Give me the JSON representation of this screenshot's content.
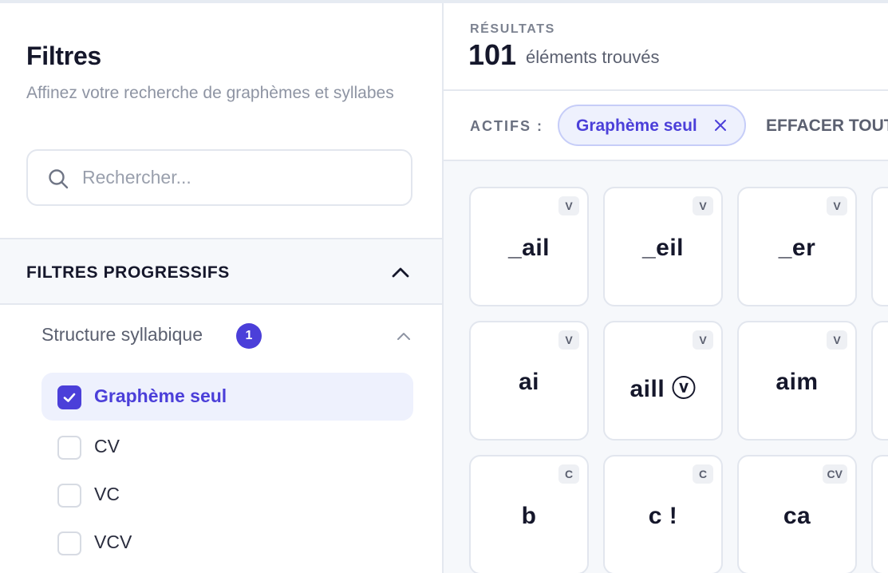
{
  "sidebar": {
    "title": "Filtres",
    "subtitle": "Affinez votre recherche de graphèmes et syllabes",
    "search": {
      "placeholder": "Rechercher...",
      "value": ""
    },
    "progressive": {
      "label": "FILTRES PROGRESSIFS",
      "group": {
        "label": "Structure syllabique",
        "badge": "1",
        "options": [
          {
            "label": "Graphème seul",
            "checked": true
          },
          {
            "label": "CV",
            "checked": false
          },
          {
            "label": "VC",
            "checked": false
          },
          {
            "label": "VCV",
            "checked": false
          }
        ]
      }
    }
  },
  "results": {
    "kicker": "RÉSULTATS",
    "count": "101",
    "count_label": "éléments trouvés",
    "active_label": "ACTIFS :",
    "chip_label": "Graphème seul",
    "clear_all": "EFFACER TOUT",
    "cards": [
      {
        "text": "_ail",
        "tag": "V"
      },
      {
        "text": "_eil",
        "tag": "V"
      },
      {
        "text": "_er",
        "tag": "V"
      },
      {
        "text": "ai",
        "tag": "V"
      },
      {
        "text": "aill ⓥ",
        "tag": "V"
      },
      {
        "text": "aim",
        "tag": "V"
      },
      {
        "text": "b",
        "tag": "C"
      },
      {
        "text": "c !",
        "tag": "C"
      },
      {
        "text": "ca",
        "tag": "CV"
      }
    ]
  },
  "colors": {
    "accent": "#4b3fd9",
    "accent_bg": "#eef1fd",
    "border": "#e2e6ee"
  }
}
